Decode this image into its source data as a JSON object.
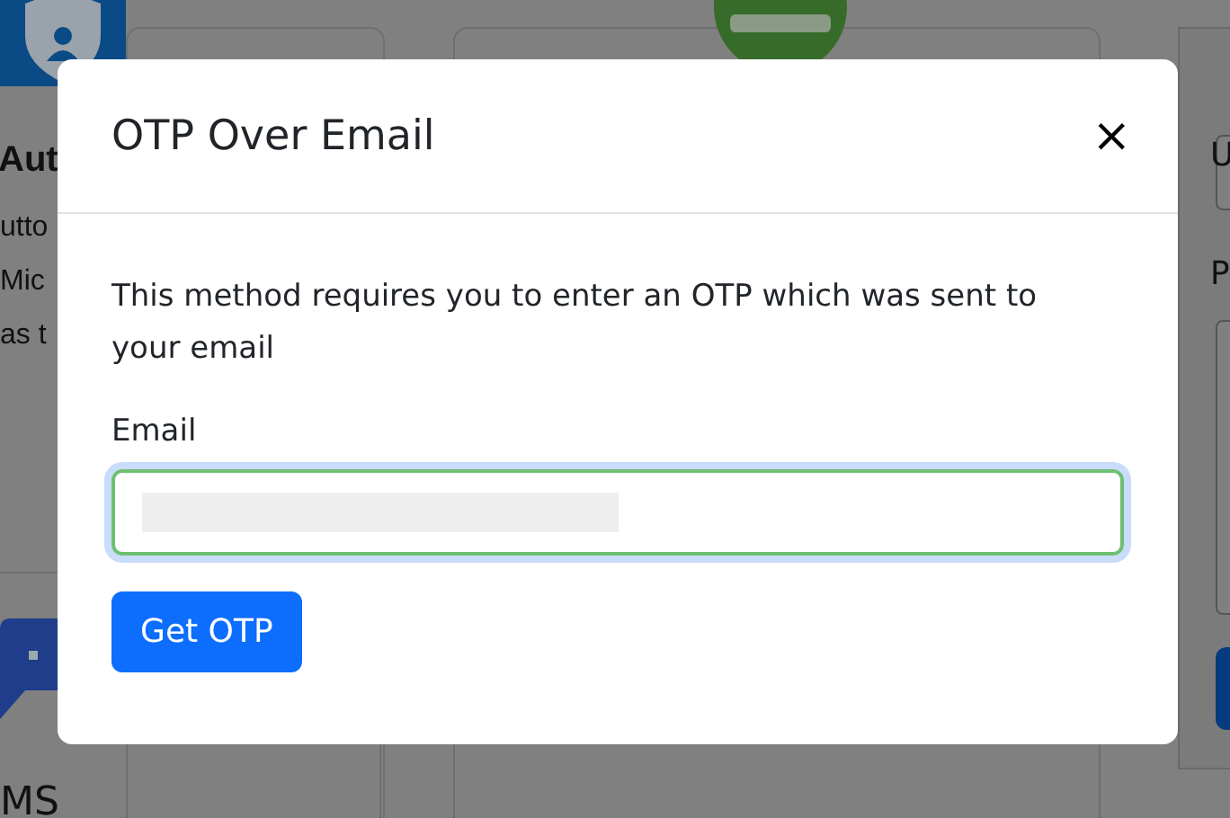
{
  "background": {
    "left_card": {
      "title": "Aut",
      "lines": [
        "utto",
        "Mic",
        "as t"
      ]
    },
    "bottom_card": {
      "title": "MS"
    },
    "right_panel": {
      "labels": [
        "U",
        "P"
      ]
    }
  },
  "dialog": {
    "title": "OTP Over Email",
    "close": "×",
    "message": "This method requires you to enter an OTP which was sent to your email",
    "field": {
      "label": "Email",
      "focused": true
    },
    "button": "Get OTP"
  }
}
